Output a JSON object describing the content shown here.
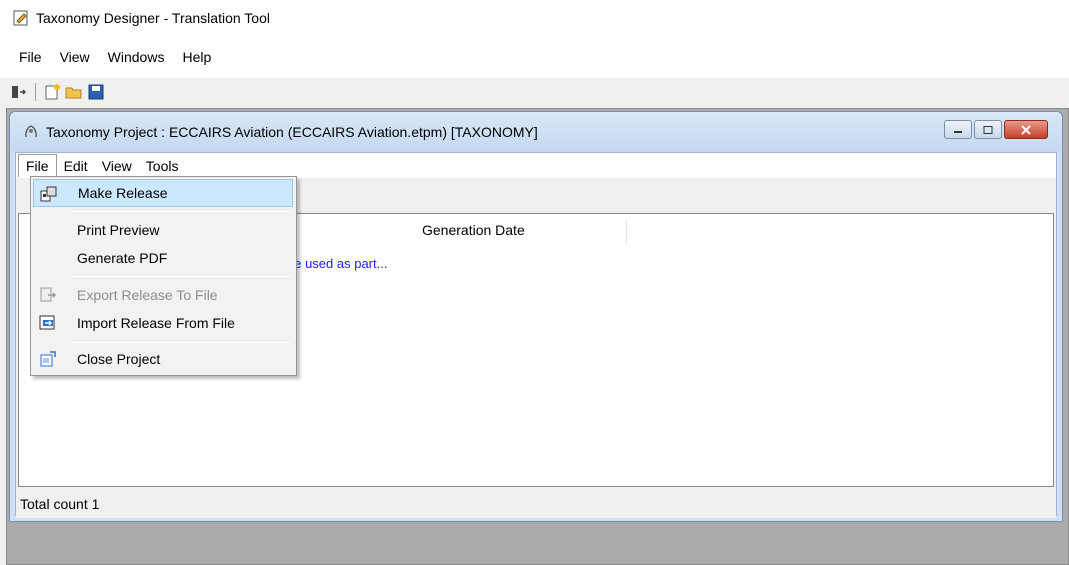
{
  "app": {
    "title": "Taxonomy Designer - Translation Tool"
  },
  "menubar": {
    "items": [
      "File",
      "View",
      "Windows",
      "Help"
    ]
  },
  "child_window": {
    "title": "Taxonomy Project : ECCAIRS Aviation (ECCAIRS Aviation.etpm) [TAXONOMY]",
    "menu": [
      "File",
      "Edit",
      "View",
      "Tools"
    ],
    "columns": [
      "Generation Date"
    ],
    "row_text": "be used as part...",
    "status": "Total count 1"
  },
  "dropdown": {
    "make_release": "Make Release",
    "print_preview": "Print Preview",
    "generate_pdf": "Generate PDF",
    "export_release": "Export Release To File",
    "import_release": "Import Release From File",
    "close_project": "Close Project"
  },
  "colors": {
    "accent": "#cce8ff",
    "link": "#1c1cf0",
    "close": "#c4402a"
  },
  "icons": [
    "edit-doc-icon",
    "exit-icon",
    "new-icon",
    "open-folder-icon",
    "save-icon",
    "project-icon",
    "make-release-icon",
    "export-icon",
    "import-icon",
    "close-project-icon"
  ]
}
